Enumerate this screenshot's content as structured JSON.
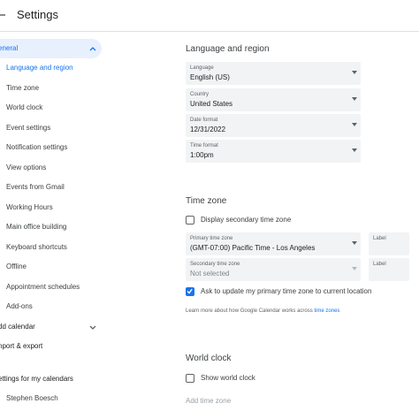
{
  "header": {
    "title": "Settings"
  },
  "sidebar": {
    "general": "eneral",
    "items": [
      "Language and region",
      "Time zone",
      "World clock",
      "Event settings",
      "Notification settings",
      "View options",
      "Events from Gmail",
      "Working Hours",
      "Main office building",
      "Keyboard shortcuts",
      "Offline",
      "Appointment schedules",
      "Add-ons"
    ],
    "add_calendar": "dd calendar",
    "import_export": "nport & export",
    "my_calendars": "ettings for my calendars",
    "calendar_owner": "Stephen Boesch"
  },
  "language_region": {
    "title": "Language and region",
    "language": {
      "label": "Language",
      "value": "English (US)"
    },
    "country": {
      "label": "Country",
      "value": "United States"
    },
    "date_format": {
      "label": "Date format",
      "value": "12/31/2022"
    },
    "time_format": {
      "label": "Time format",
      "value": "1:00pm"
    }
  },
  "time_zone": {
    "title": "Time zone",
    "display_secondary": {
      "label": "Display secondary time zone",
      "checked": false
    },
    "primary": {
      "label": "Primary time zone",
      "value": "(GMT-07:00) Pacific Time - Los Angeles",
      "label_field": "Label"
    },
    "secondary": {
      "label": "Secondary time zone",
      "value": "Not selected",
      "label_field": "Label"
    },
    "ask_update": {
      "label": "Ask to update my primary time zone to current location",
      "checked": true
    },
    "help_text": "Learn more about how Google Calendar works across ",
    "help_link": "time zones"
  },
  "world_clock": {
    "title": "World clock",
    "show_world_clock": {
      "label": "Show world clock",
      "checked": false
    },
    "add_time_zone": "Add time zone"
  },
  "colors": {
    "accent": "#1a73e8",
    "selected_bg": "#e8f0fe",
    "field_bg": "#f1f3f4"
  }
}
